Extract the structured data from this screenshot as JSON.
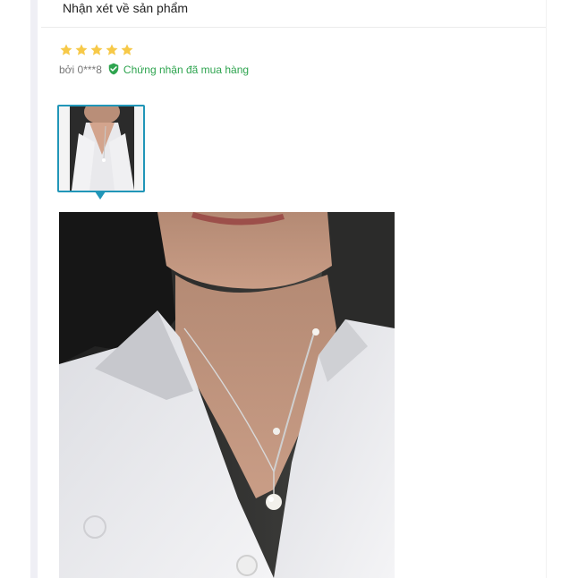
{
  "review": {
    "section_title": "Nhận xét về sản phẩm",
    "rating": 5,
    "rating_max": 5,
    "author": "bởi 0***8",
    "verified_label": "Chứng nhận đã mua hàng"
  },
  "colors": {
    "star": "#f7c948",
    "verified": "#2ea44f",
    "thumb_border": "#2196b8"
  },
  "icons": [
    "star-icon",
    "verified-check-icon"
  ]
}
